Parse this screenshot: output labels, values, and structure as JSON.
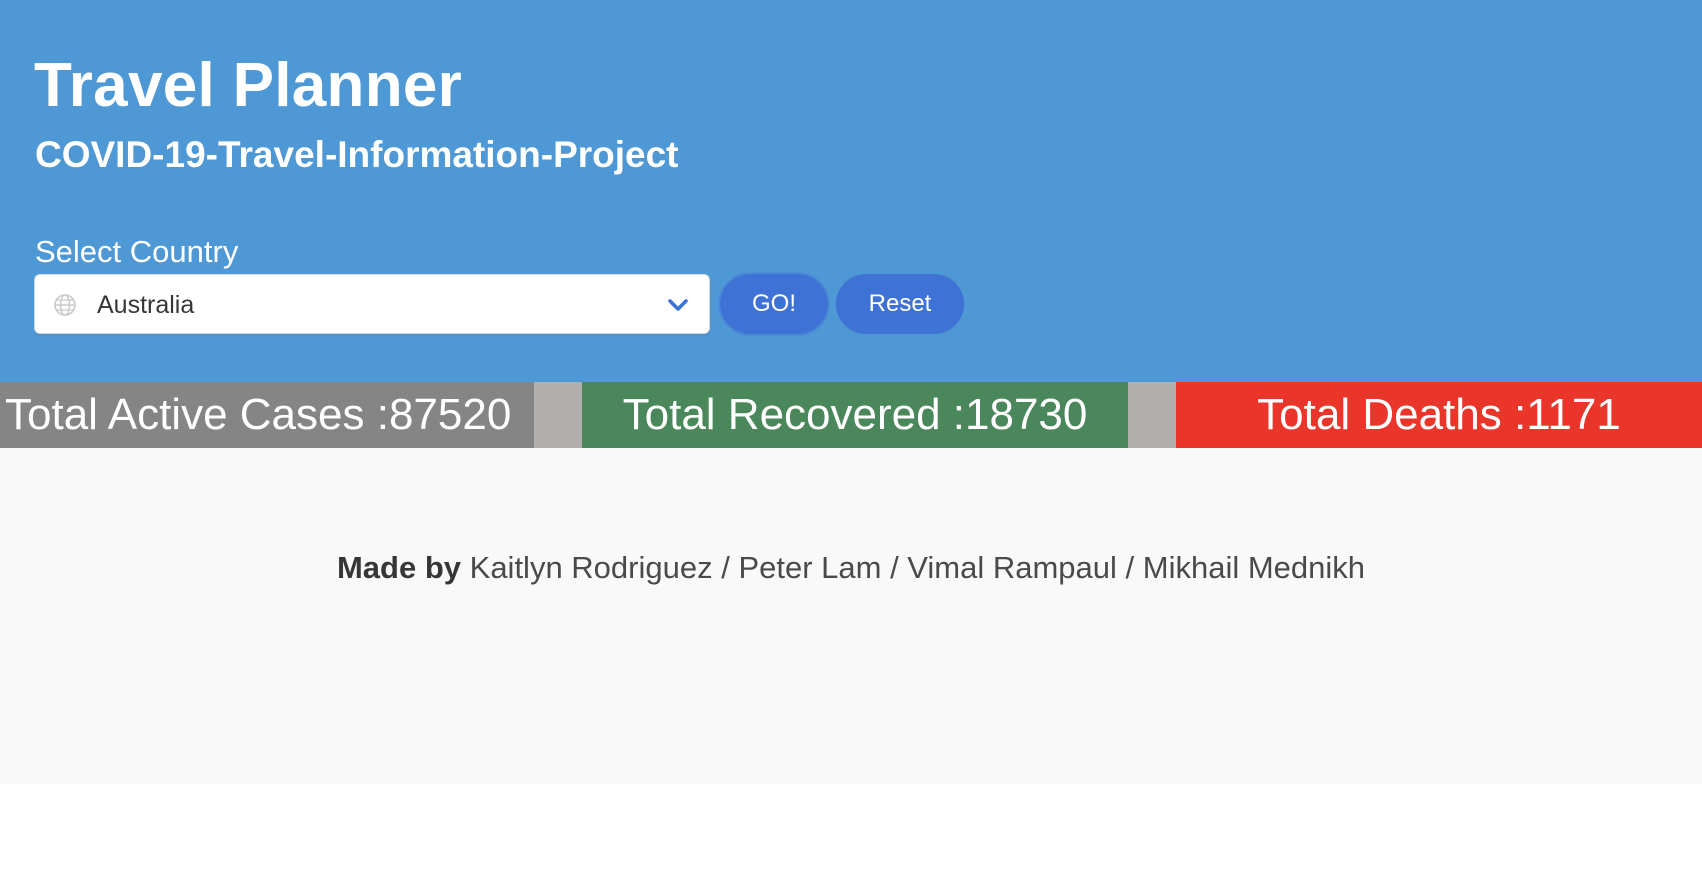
{
  "header": {
    "title": "Travel Planner",
    "subtitle": "COVID-19-Travel-Information-Project"
  },
  "form": {
    "select_label": "Select Country",
    "selected_country": "Australia",
    "globe_icon": "globe-icon",
    "dropdown_icon": "chevron-down-icon",
    "go_label": "GO!",
    "reset_label": "Reset"
  },
  "stats": {
    "active_label": "Total Active Cases :87520",
    "recovered_label": "Total Recovered :18730",
    "deaths_label": "Total Deaths :1171"
  },
  "footer": {
    "made_by_label": "Made by",
    "authors": "Kaitlyn Rodriguez / Peter Lam / Vimal Rampaul / Mikhail Mednikh"
  },
  "colors": {
    "hero": "#4f98d6",
    "button": "#3e72d4",
    "active": "#858585",
    "recovered": "#4a875a",
    "deaths": "#e9352a",
    "footer": "#f9f9f9"
  }
}
